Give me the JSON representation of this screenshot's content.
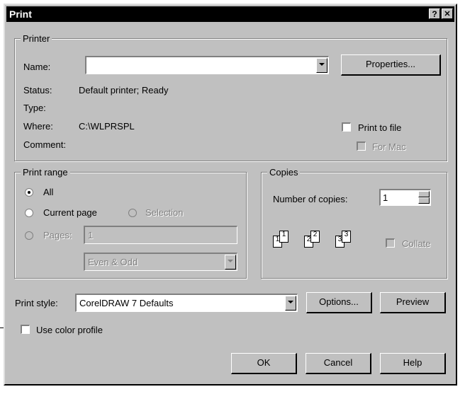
{
  "window": {
    "title": "Print",
    "help_glyph": "?",
    "close_glyph": "✕"
  },
  "printer": {
    "legend": "Printer",
    "name_label": "Name:",
    "name_value": "",
    "properties_button": "Properties...",
    "status_label": "Status:",
    "status_value": "Default printer; Ready",
    "type_label": "Type:",
    "type_value": "",
    "where_label": "Where:",
    "where_value": "C:\\WLPRSPL",
    "comment_label": "Comment:",
    "comment_value": "",
    "print_to_file": "Print to file",
    "for_mac": "For Mac"
  },
  "print_range": {
    "legend": "Print range",
    "all": "All",
    "current_page": "Current page",
    "selection": "Selection",
    "pages": "Pages:",
    "pages_value": "1",
    "even_odd": "Even & Odd"
  },
  "copies": {
    "legend": "Copies",
    "number_label": "Number of copies:",
    "number_value": "1",
    "collate": "Collate",
    "page_labels": [
      "1",
      "1",
      "2",
      "2",
      "3",
      "3"
    ]
  },
  "style": {
    "label": "Print style:",
    "value": "CorelDRAW 7 Defaults",
    "options_button": "Options...",
    "preview_button": "Preview"
  },
  "use_color_profile": "Use color profile",
  "buttons": {
    "ok": "OK",
    "cancel": "Cancel",
    "help": "Help"
  }
}
